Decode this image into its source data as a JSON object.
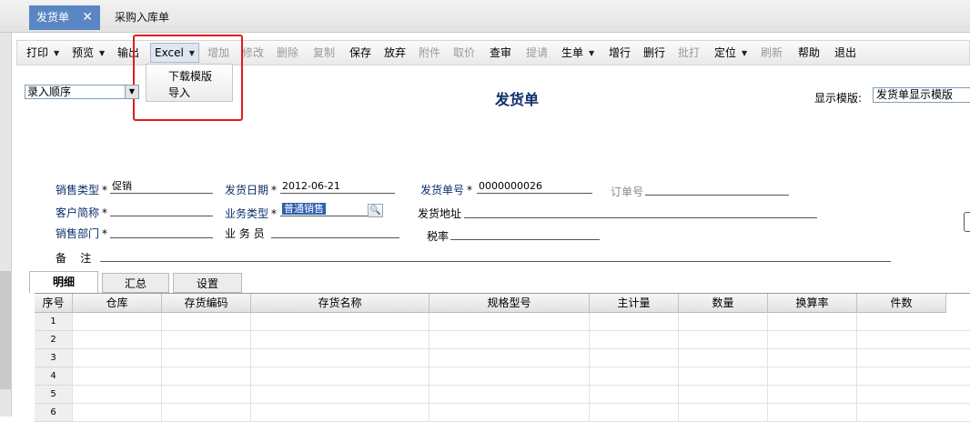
{
  "tabs": [
    {
      "label": "发货单",
      "close": "✕"
    },
    {
      "label": "采购入库单"
    }
  ],
  "toolbar": {
    "items": [
      {
        "label": "打印",
        "dropdown": true,
        "disabled": false
      },
      {
        "label": "预览",
        "dropdown": true,
        "disabled": false
      },
      {
        "label": "输出",
        "dropdown": false,
        "disabled": false
      },
      {
        "label": "Excel",
        "dropdown": true,
        "disabled": false
      },
      {
        "label": "增加",
        "dropdown": false,
        "disabled": true
      },
      {
        "label": "修改",
        "dropdown": false,
        "disabled": true
      },
      {
        "label": "删除",
        "dropdown": false,
        "disabled": true
      },
      {
        "label": "复制",
        "dropdown": false,
        "disabled": true
      },
      {
        "label": "保存",
        "dropdown": false,
        "disabled": false
      },
      {
        "label": "放弃",
        "dropdown": false,
        "disabled": false
      },
      {
        "label": "附件",
        "dropdown": false,
        "disabled": true
      },
      {
        "label": "取价",
        "dropdown": false,
        "disabled": true
      },
      {
        "label": "查审",
        "dropdown": false,
        "disabled": false
      },
      {
        "label": "提请",
        "dropdown": false,
        "disabled": true
      },
      {
        "label": "生单",
        "dropdown": true,
        "disabled": false
      },
      {
        "label": "增行",
        "dropdown": false,
        "disabled": false
      },
      {
        "label": "删行",
        "dropdown": false,
        "disabled": false
      },
      {
        "label": "批打",
        "dropdown": false,
        "disabled": true
      },
      {
        "label": "定位",
        "dropdown": true,
        "disabled": false
      },
      {
        "label": "刷新",
        "dropdown": false,
        "disabled": true
      },
      {
        "label": "帮助",
        "dropdown": false,
        "disabled": false
      },
      {
        "label": "退出",
        "dropdown": false,
        "disabled": false
      }
    ],
    "excel_menu": [
      "下载模版",
      "导入"
    ]
  },
  "header": {
    "order_select": "录入顺序",
    "title": "发货单",
    "template_label": "显示模版:",
    "template_value": "发货单显示模版"
  },
  "fields": {
    "sales_type": {
      "label": "销售类型",
      "value": "促销"
    },
    "ship_date": {
      "label": "发货日期",
      "value": "2012-06-21"
    },
    "ship_no": {
      "label": "发货单号",
      "value": "0000000026"
    },
    "order_no": {
      "label": "订单号",
      "value": ""
    },
    "customer": {
      "label": "客户简称",
      "value": ""
    },
    "biz_type": {
      "label": "业务类型",
      "value": "普通销售"
    },
    "ship_addr": {
      "label": "发货地址",
      "value": ""
    },
    "sales_dept": {
      "label": "销售部门",
      "value": ""
    },
    "salesman": {
      "label": "业 务 员",
      "value": ""
    },
    "tax_rate": {
      "label": "税率",
      "value": ""
    },
    "remark": {
      "label": "备    注",
      "value": ""
    },
    "required_mark": "*"
  },
  "detail_tabs": [
    "明细",
    "汇总",
    "设置"
  ],
  "grid": {
    "columns": [
      "序号",
      "仓库",
      "存货编码",
      "存货名称",
      "规格型号",
      "主计量",
      "数量",
      "换算率",
      "件数"
    ],
    "rows": [
      "1",
      "2",
      "3",
      "4",
      "5",
      "6"
    ]
  }
}
